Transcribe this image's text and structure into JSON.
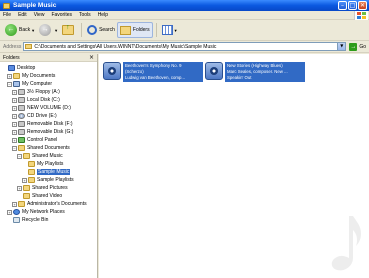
{
  "window": {
    "title": "Sample Music",
    "controls": {
      "minimize": "–",
      "maximize": "□",
      "close": "✕"
    }
  },
  "menubar": {
    "items": [
      "File",
      "Edit",
      "View",
      "Favorites",
      "Tools",
      "Help"
    ]
  },
  "toolbar": {
    "back_label": "Back",
    "back_icon": "back-arrow-icon",
    "forward_icon": "forward-arrow-icon",
    "up_icon": "folder-up-icon",
    "search_label": "Search",
    "folders_label": "Folders",
    "views_icon": "views-icon"
  },
  "addressbar": {
    "label": "Address",
    "value": "C:\\Documents and Settings\\All Users.WINNT\\Documents\\My Music\\Sample Music",
    "go_label": "Go"
  },
  "folders_pane": {
    "title": "Folders",
    "close": "×",
    "tree": [
      {
        "label": "Desktop",
        "indent": 0,
        "icon": "desktop-icon",
        "expander": ""
      },
      {
        "label": "My Documents",
        "indent": 1,
        "icon": "folder-icon",
        "expander": "+"
      },
      {
        "label": "My Computer",
        "indent": 1,
        "icon": "computer-icon",
        "expander": "−"
      },
      {
        "label": "3½ Floppy (A:)",
        "indent": 2,
        "icon": "drive-icon",
        "expander": "+"
      },
      {
        "label": "Local Disk (C:)",
        "indent": 2,
        "icon": "drive-icon",
        "expander": "+"
      },
      {
        "label": "NEW VOLUME (D:)",
        "indent": 2,
        "icon": "drive-icon",
        "expander": "+"
      },
      {
        "label": "CD Drive (E:)",
        "indent": 2,
        "icon": "cd-icon",
        "expander": "+"
      },
      {
        "label": "Removable Disk (F:)",
        "indent": 2,
        "icon": "drive-icon",
        "expander": "+"
      },
      {
        "label": "Removable Disk (G:)",
        "indent": 2,
        "icon": "drive-icon",
        "expander": "+"
      },
      {
        "label": "Control Panel",
        "indent": 2,
        "icon": "panel-icon",
        "expander": "+"
      },
      {
        "label": "Shared Documents",
        "indent": 2,
        "icon": "folder-icon",
        "expander": "−"
      },
      {
        "label": "Shared Music",
        "indent": 3,
        "icon": "folder-icon",
        "expander": "−"
      },
      {
        "label": "My Playlists",
        "indent": 4,
        "icon": "folder-icon",
        "expander": ""
      },
      {
        "label": "Sample Music",
        "indent": 4,
        "icon": "folder-icon",
        "expander": "",
        "selected": true
      },
      {
        "label": "Sample Playlists",
        "indent": 4,
        "icon": "folder-icon",
        "expander": "+"
      },
      {
        "label": "Shared Pictures",
        "indent": 3,
        "icon": "folder-icon",
        "expander": "+"
      },
      {
        "label": "Shared Video",
        "indent": 3,
        "icon": "folder-icon",
        "expander": ""
      },
      {
        "label": "Administrator's Documents",
        "indent": 2,
        "icon": "folder-icon",
        "expander": "+"
      },
      {
        "label": "My Network Places",
        "indent": 1,
        "icon": "network-icon",
        "expander": "+"
      },
      {
        "label": "Recycle Bin",
        "indent": 1,
        "icon": "recycle-bin-icon",
        "expander": ""
      }
    ]
  },
  "files": [
    {
      "icon": "audio-file-icon",
      "lines": [
        "Beethoven's Symphony No. 9",
        "(Scherzo)",
        "Ludwig van Beethoven, comp..."
      ]
    },
    {
      "icon": "audio-file-icon",
      "lines": [
        "New Stories (Highway Blues)",
        "Marc Seales, composer. New ...",
        "Speakin' Out"
      ]
    }
  ]
}
